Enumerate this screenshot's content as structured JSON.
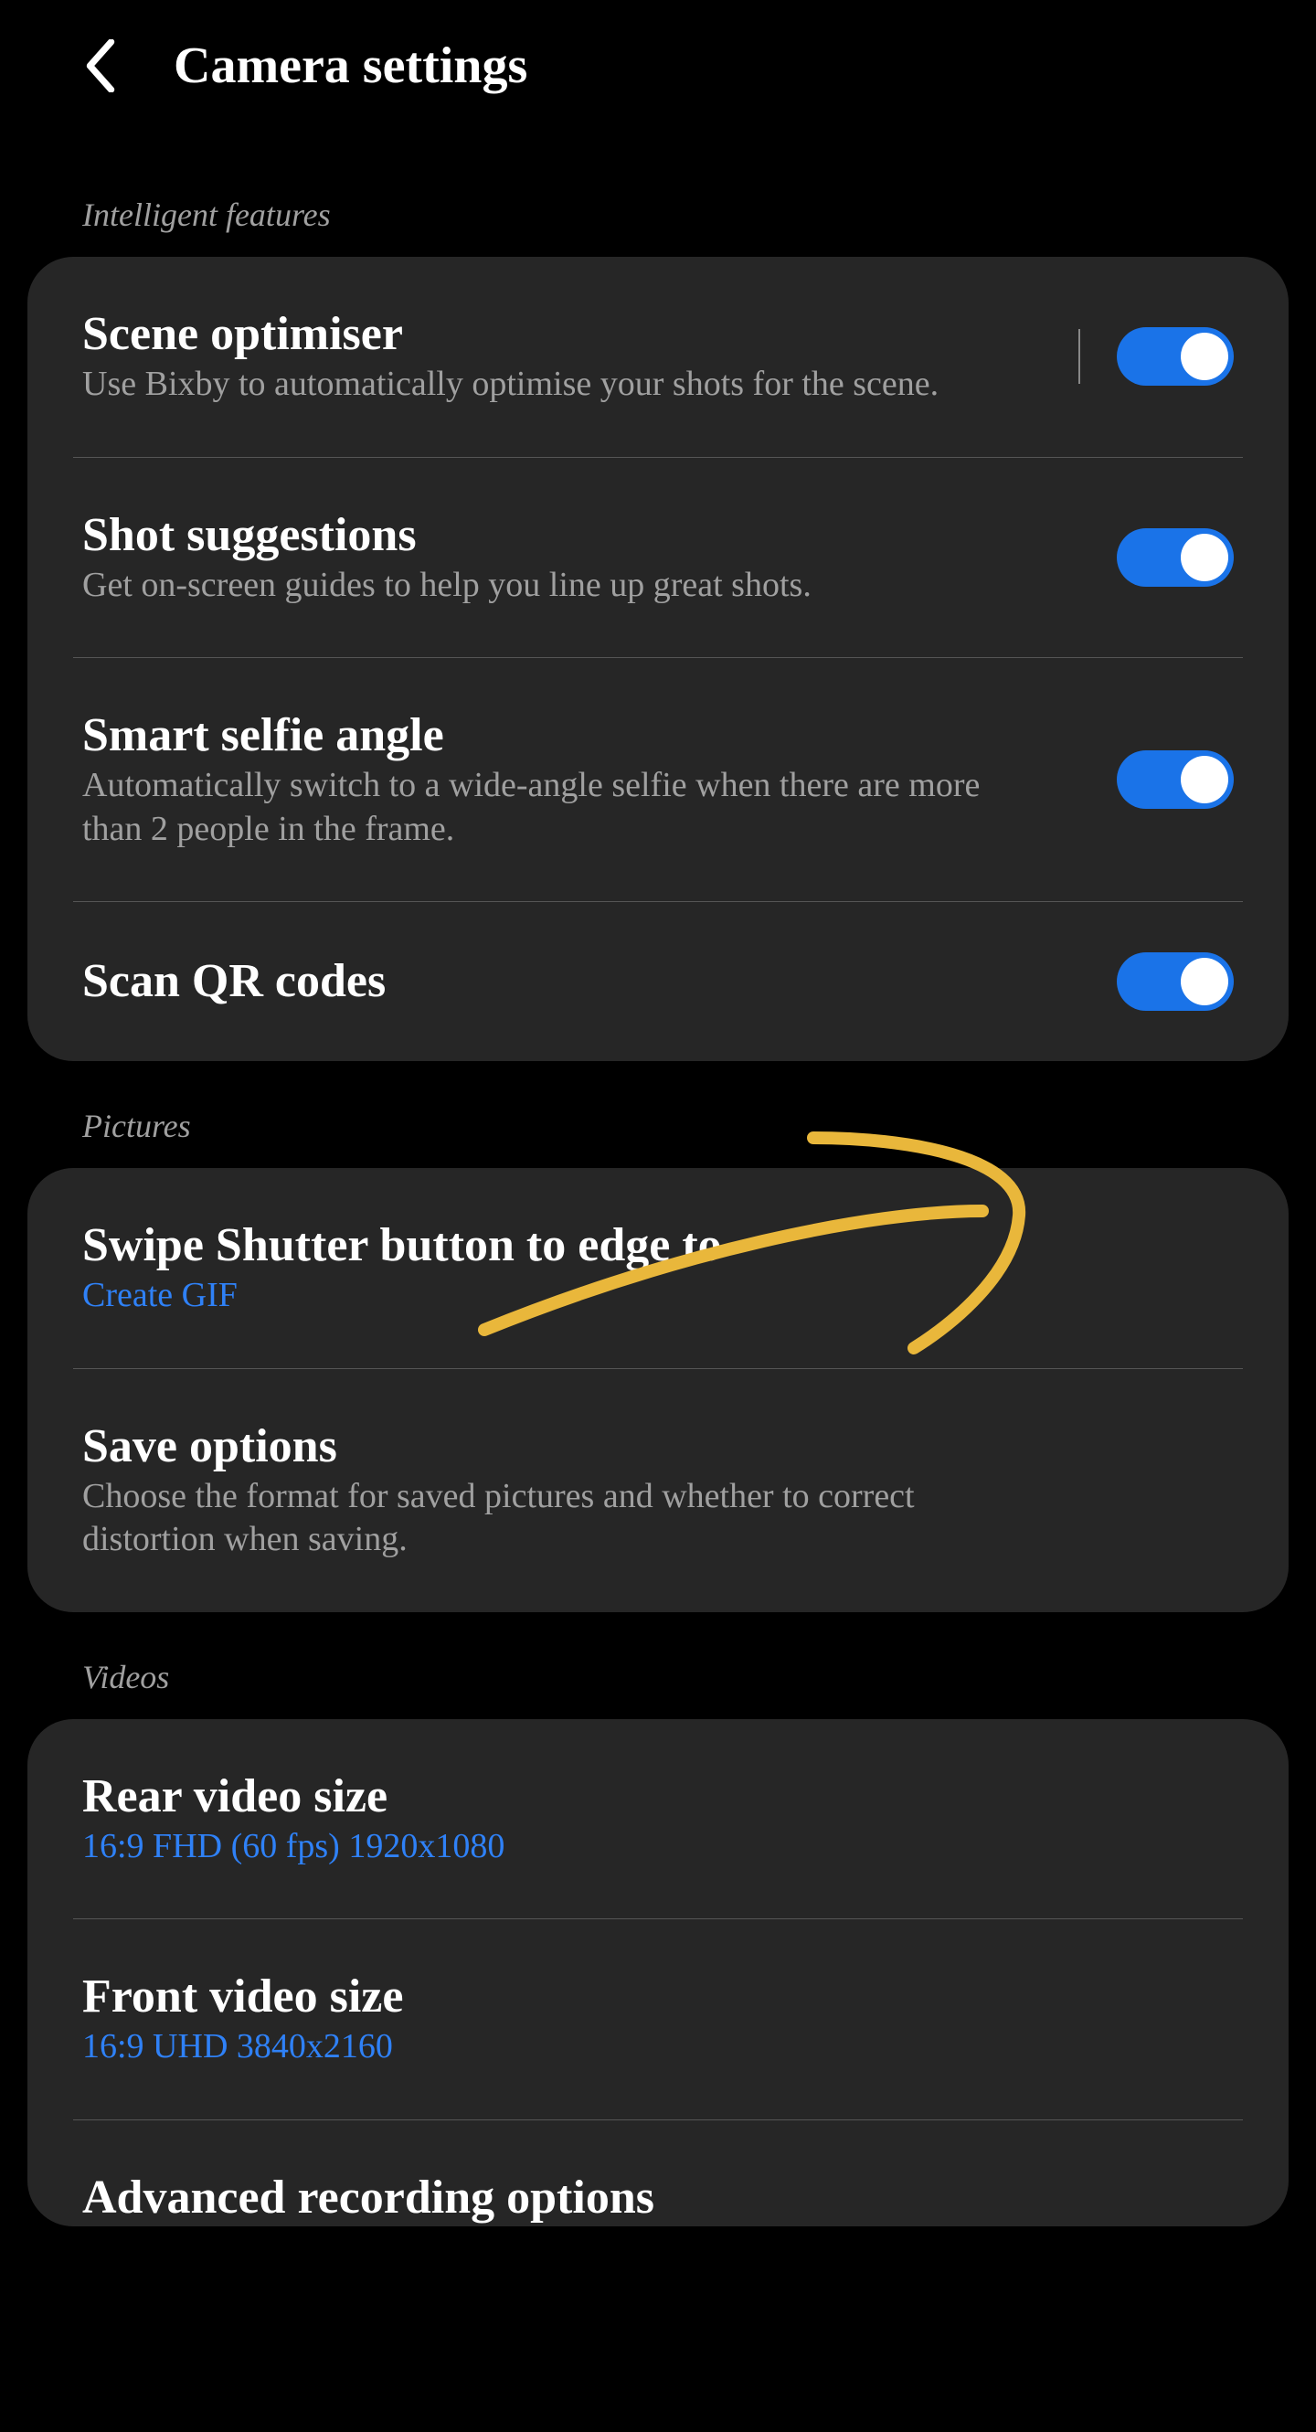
{
  "header": {
    "title": "Camera settings"
  },
  "sections": {
    "intelligent_label": "Intelligent features",
    "pictures_label": "Pictures",
    "videos_label": "Videos"
  },
  "intelligent": {
    "scene_optimiser": {
      "title": "Scene optimiser",
      "sub": "Use Bixby to automatically optimise your shots for the scene.",
      "on": true
    },
    "shot_suggestions": {
      "title": "Shot suggestions",
      "sub": "Get on-screen guides to help you line up great shots.",
      "on": true
    },
    "smart_selfie": {
      "title": "Smart selfie angle",
      "sub": "Automatically switch to a wide-angle selfie when there are more than 2 people in the frame.",
      "on": true
    },
    "scan_qr": {
      "title": "Scan QR codes",
      "on": true
    }
  },
  "pictures": {
    "swipe_shutter": {
      "title": "Swipe Shutter button to edge to",
      "sub": "Create GIF"
    },
    "save_options": {
      "title": "Save options",
      "sub": "Choose the format for saved pictures and whether to correct distortion when saving."
    }
  },
  "videos": {
    "rear": {
      "title": "Rear video size",
      "sub": "16:9 FHD (60 fps) 1920x1080"
    },
    "front": {
      "title": "Front video size",
      "sub": "16:9 UHD 3840x2160"
    },
    "advanced": {
      "title": "Advanced recording options"
    }
  }
}
